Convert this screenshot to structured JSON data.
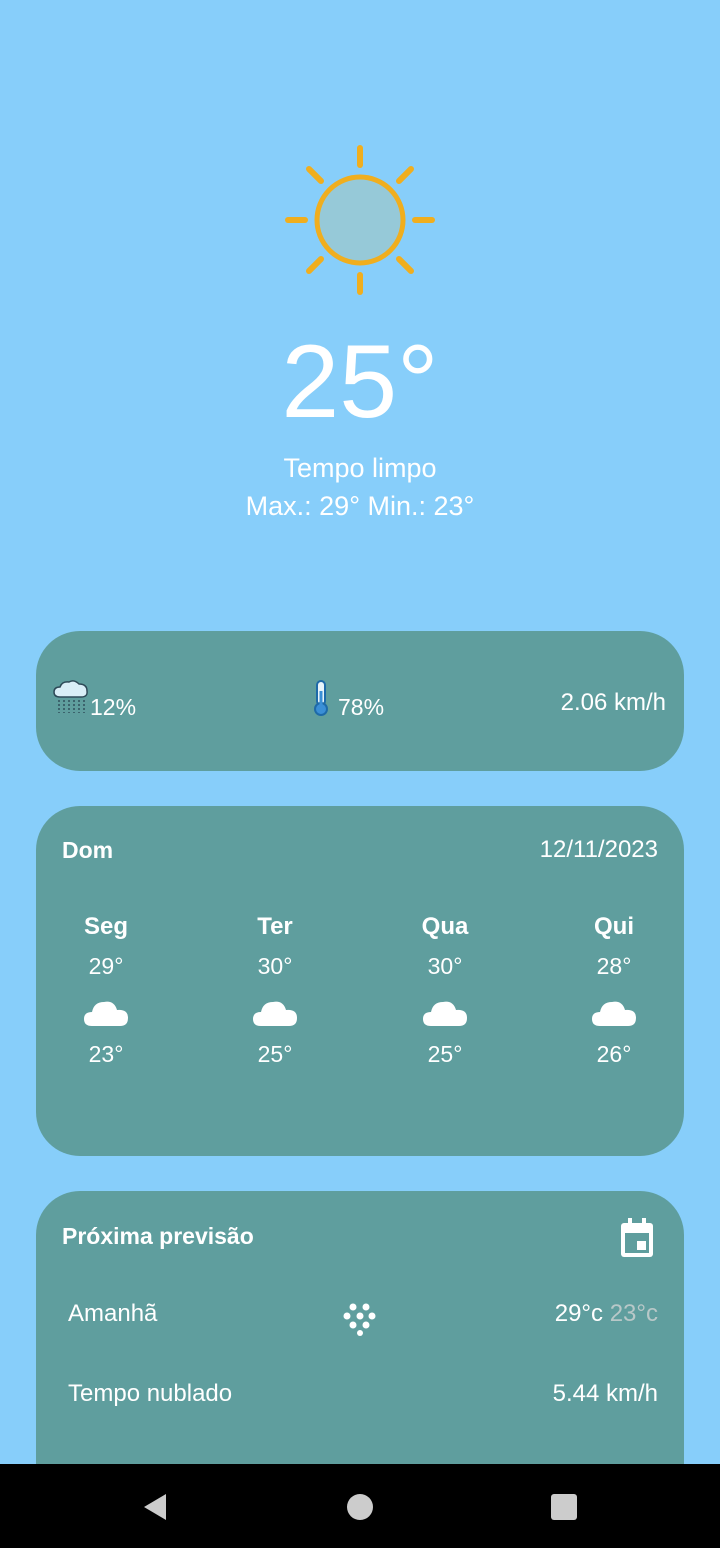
{
  "current": {
    "temperature": "25°",
    "condition": "Tempo limpo",
    "max_min": "Max.: 29° Min.: 23°",
    "icon": "sun-icon"
  },
  "stats": {
    "rain_icon": "rain-cloud-icon",
    "rain": "12%",
    "humidity_icon": "thermometer-icon",
    "humidity": "78%",
    "wind": "2.06 km/h"
  },
  "week": {
    "today": "Dom",
    "date": "12/11/2023",
    "days": [
      {
        "day": "Seg",
        "max": "29°",
        "min": "23°",
        "icon": "cloud-icon"
      },
      {
        "day": "Ter",
        "max": "30°",
        "min": "25°",
        "icon": "cloud-icon"
      },
      {
        "day": "Qua",
        "max": "30°",
        "min": "25°",
        "icon": "cloud-icon"
      },
      {
        "day": "Qui",
        "max": "28°",
        "min": "26°",
        "icon": "cloud-icon"
      }
    ]
  },
  "next": {
    "title": "Próxima previsão",
    "calendar_icon": "calendar-icon",
    "label": "Amanhã",
    "weather_icon": "dots-icon",
    "max": "29°c",
    "min": "23°c",
    "condition": "Tempo nublado",
    "wind": "5.44 km/h"
  },
  "colors": {
    "background": "#87CEFA",
    "card": "#5F9E9E",
    "sun": "#F0AE1E",
    "min_temp_text": "#B8C8C8"
  },
  "navbar": {
    "icons": [
      "back-icon",
      "home-icon",
      "recents-icon"
    ]
  }
}
